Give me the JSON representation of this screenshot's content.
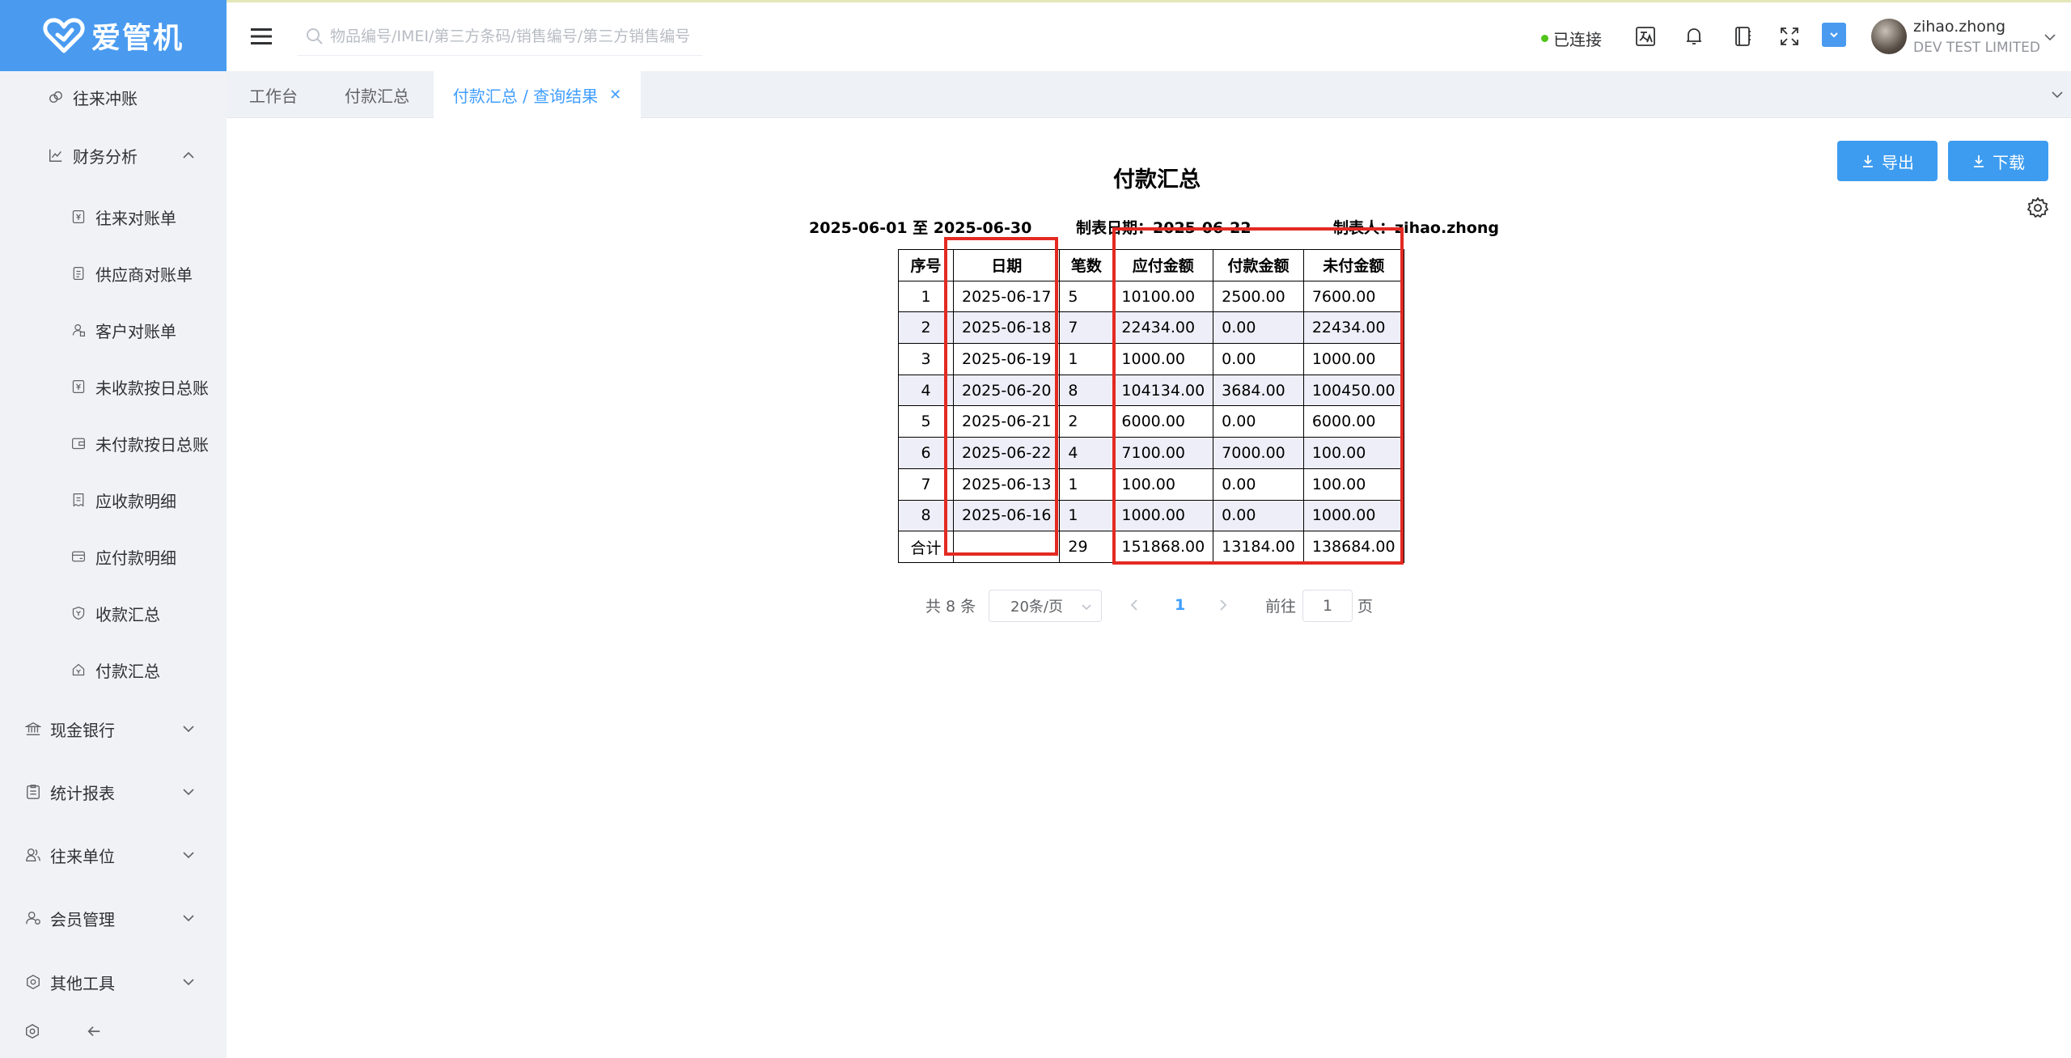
{
  "app": {
    "logo_text": "爱管机"
  },
  "sidebar": {
    "items": [
      {
        "label": "往来冲账"
      },
      {
        "label": "财务分析"
      },
      {
        "label": "往来对账单"
      },
      {
        "label": "供应商对账单"
      },
      {
        "label": "客户对账单"
      },
      {
        "label": "未收款按日总账"
      },
      {
        "label": "未付款按日总账"
      },
      {
        "label": "应收款明细"
      },
      {
        "label": "应付款明细"
      },
      {
        "label": "收款汇总"
      },
      {
        "label": "付款汇总"
      },
      {
        "label": "现金银行"
      },
      {
        "label": "统计报表"
      },
      {
        "label": "往来单位"
      },
      {
        "label": "会员管理"
      },
      {
        "label": "其他工具"
      }
    ]
  },
  "header": {
    "search_placeholder": "物品编号/IMEI/第三方条码/销售编号/第三方销售编号",
    "connection_status": "已连接",
    "user_name": "zihao.zhong",
    "company": "DEV TEST LIMITED"
  },
  "tabs": [
    {
      "label": "工作台"
    },
    {
      "label": "付款汇总"
    },
    {
      "label": "付款汇总 / 查询结果"
    }
  ],
  "toolbar": {
    "export_label": "导出",
    "download_label": "下载"
  },
  "report": {
    "title": "付款汇总",
    "date_range": "2025-06-01 至 2025-06-30",
    "made_date": "制表日期：2025-06-22",
    "maker": "制表人：zihao.zhong",
    "columns": [
      "序号",
      "日期",
      "笔数",
      "应付金额",
      "付款金额",
      "未付金额"
    ],
    "rows": [
      [
        "1",
        "2025-06-17",
        "5",
        "10100.00",
        "2500.00",
        "7600.00"
      ],
      [
        "2",
        "2025-06-18",
        "7",
        "22434.00",
        "0.00",
        "22434.00"
      ],
      [
        "3",
        "2025-06-19",
        "1",
        "1000.00",
        "0.00",
        "1000.00"
      ],
      [
        "4",
        "2025-06-20",
        "8",
        "104134.00",
        "3684.00",
        "100450.00"
      ],
      [
        "5",
        "2025-06-21",
        "2",
        "6000.00",
        "0.00",
        "6000.00"
      ],
      [
        "6",
        "2025-06-22",
        "4",
        "7100.00",
        "7000.00",
        "100.00"
      ],
      [
        "7",
        "2025-06-13",
        "1",
        "100.00",
        "0.00",
        "100.00"
      ],
      [
        "8",
        "2025-06-16",
        "1",
        "1000.00",
        "0.00",
        "1000.00"
      ]
    ],
    "total": [
      "合计",
      "",
      "29",
      "151868.00",
      "13184.00",
      "138684.00"
    ]
  },
  "pagination": {
    "total_text": "共 8 条",
    "page_size": "20条/页",
    "current_page": "1",
    "goto_prefix": "前往",
    "goto_value": "1",
    "goto_suffix": "页"
  },
  "colors": {
    "accent": "#409eff",
    "button": "#3d9cf0",
    "highlight_box": "#e32a22",
    "logo_bg": "#4a9bf0"
  }
}
